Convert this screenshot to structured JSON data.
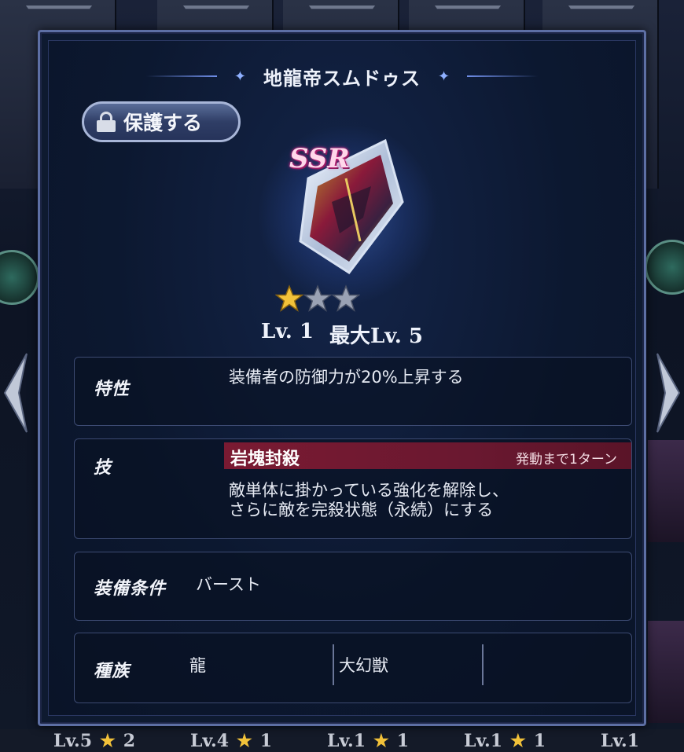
{
  "background": {
    "bottom_bar": [
      {
        "level": "Lv.5",
        "stars": "2"
      },
      {
        "level": "Lv.4",
        "stars": "1"
      },
      {
        "level": "Lv.1",
        "stars": "1"
      },
      {
        "level": "Lv.1",
        "stars": "1"
      },
      {
        "level": "Lv.1",
        "stars": ""
      }
    ]
  },
  "modal": {
    "title": "地龍帝スムドゥス",
    "protect_label": "保護する",
    "rarity": "SSR",
    "stars_filled": 1,
    "stars_total": 3,
    "level": "Lv. 1",
    "max_level": "最大Lv. 5",
    "trait": {
      "label": "特性",
      "text": "装備者の防御力が20%上昇する"
    },
    "skill": {
      "label": "技",
      "name": "岩塊封殺",
      "turns": "発動まで1ターン",
      "desc_line1": "敵単体に掛かっている強化を解除し、",
      "desc_line2": "さらに敵を完殺状態（永続）にする"
    },
    "equip": {
      "label": "装備条件",
      "value": "バースト"
    },
    "race": {
      "label": "種族",
      "values": [
        "龍",
        "大幻獣",
        ""
      ]
    }
  },
  "colors": {
    "accent": "#5d6fa4",
    "skill_bar": "#7a1a32",
    "star_gold": "#f2c23a",
    "ssr_pink": "#d02c8a"
  }
}
